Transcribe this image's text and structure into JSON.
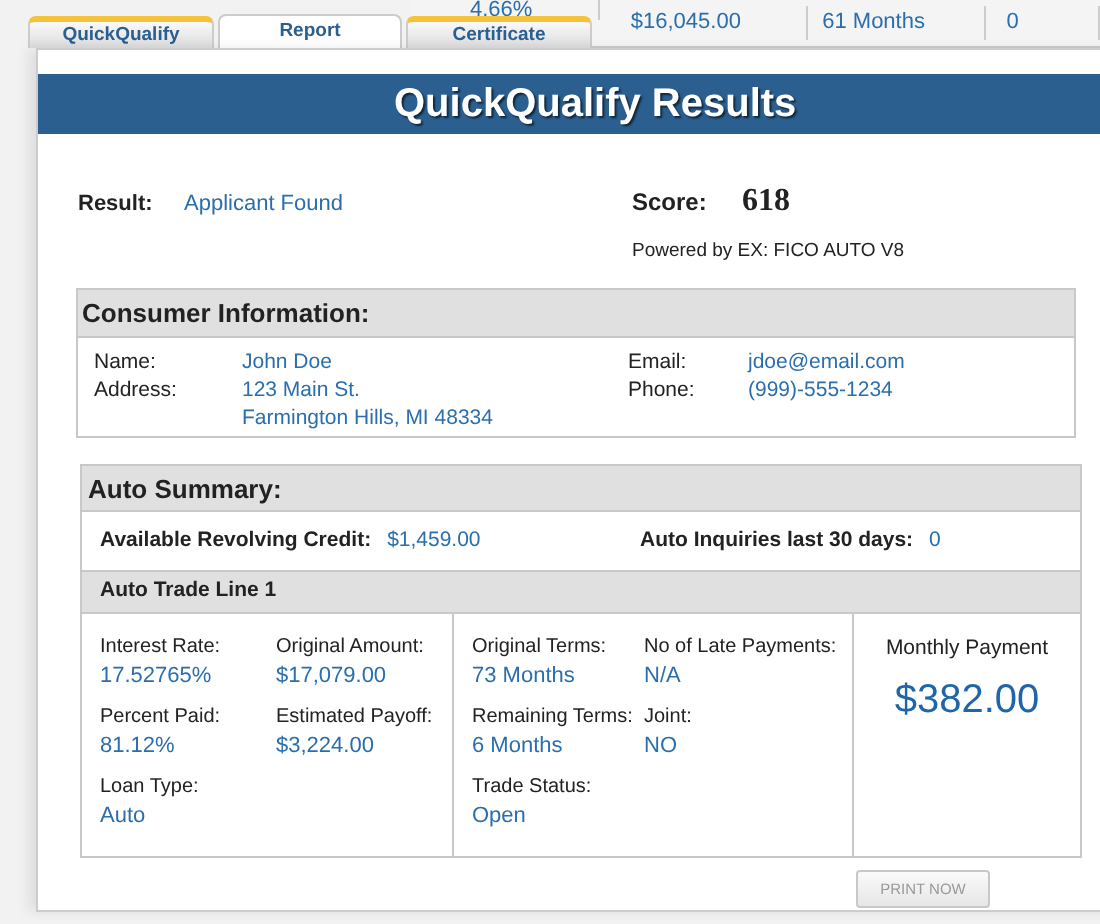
{
  "tabs": [
    {
      "label": "QuickQualify",
      "selected": false
    },
    {
      "label": "Report",
      "selected": true
    },
    {
      "label": "Certificate",
      "selected": false
    }
  ],
  "background_row": [
    "4.66%",
    "$16,045.00",
    "61 Months",
    "0"
  ],
  "title": "QuickQualify Results",
  "result": {
    "label": "Result:",
    "value": "Applicant Found"
  },
  "score": {
    "label": "Score:",
    "value": "618"
  },
  "powered_by": "Powered by EX: FICO AUTO V8",
  "consumer": {
    "title": "Consumer Information:",
    "left": [
      {
        "label": "Name:",
        "lines": [
          "John Doe"
        ]
      },
      {
        "label": "Address:",
        "lines": [
          "123 Main St.",
          "Farmington Hills, MI 48334"
        ]
      }
    ],
    "right": [
      {
        "label": "Email:",
        "lines": [
          "jdoe@email.com"
        ]
      },
      {
        "label": "Phone:",
        "lines": [
          "(999)-555-1234"
        ]
      }
    ]
  },
  "auto_summary": {
    "title": "Auto Summary:",
    "stats": [
      {
        "label": "Available Revolving Credit:",
        "value": "$1,459.00"
      },
      {
        "label": "Auto Inquiries last 30 days:",
        "value": "0"
      }
    ],
    "trade_line": {
      "title": "Auto Trade Line 1",
      "groups": [
        [
          {
            "label": "Interest Rate:",
            "value": "17.52765%"
          },
          {
            "label": "Original Amount:",
            "value": "$17,079.00"
          },
          {
            "label": "Percent Paid:",
            "value": "81.12%"
          },
          {
            "label": "Estimated Payoff:",
            "value": "$3,224.00"
          },
          {
            "label": "Loan Type:",
            "value": "Auto"
          }
        ],
        [
          {
            "label": "Original Terms:",
            "value": "73 Months"
          },
          {
            "label": "No of Late Payments:",
            "value": "N/A"
          },
          {
            "label": "Remaining Terms:",
            "value": "6 Months"
          },
          {
            "label": "Joint:",
            "value": "NO"
          },
          {
            "label": "Trade Status:",
            "value": "Open"
          }
        ]
      ],
      "monthly_payment": {
        "label": "Monthly Payment",
        "value": "$382.00"
      }
    }
  },
  "print_button": "PRINT NOW"
}
